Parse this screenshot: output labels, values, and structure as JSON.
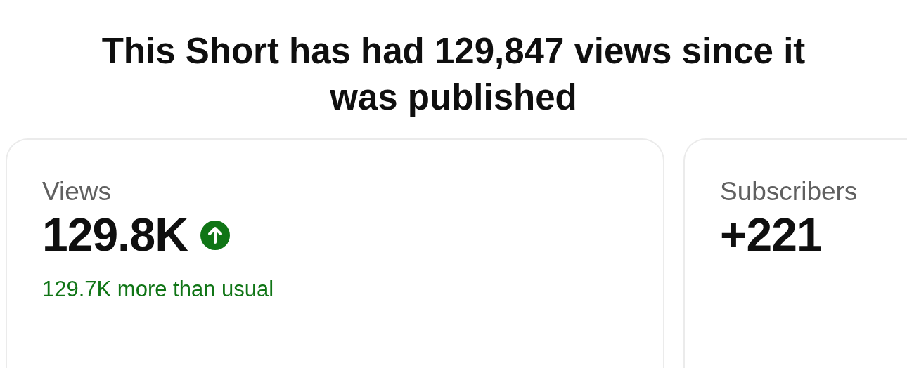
{
  "title": "This Short has had 129,847 views since it was published",
  "cards": [
    {
      "label": "Views",
      "value": "129.8K",
      "rising": true,
      "delta": "129.7K more than usual"
    },
    {
      "label": "Subscribers",
      "value": "+221"
    }
  ]
}
